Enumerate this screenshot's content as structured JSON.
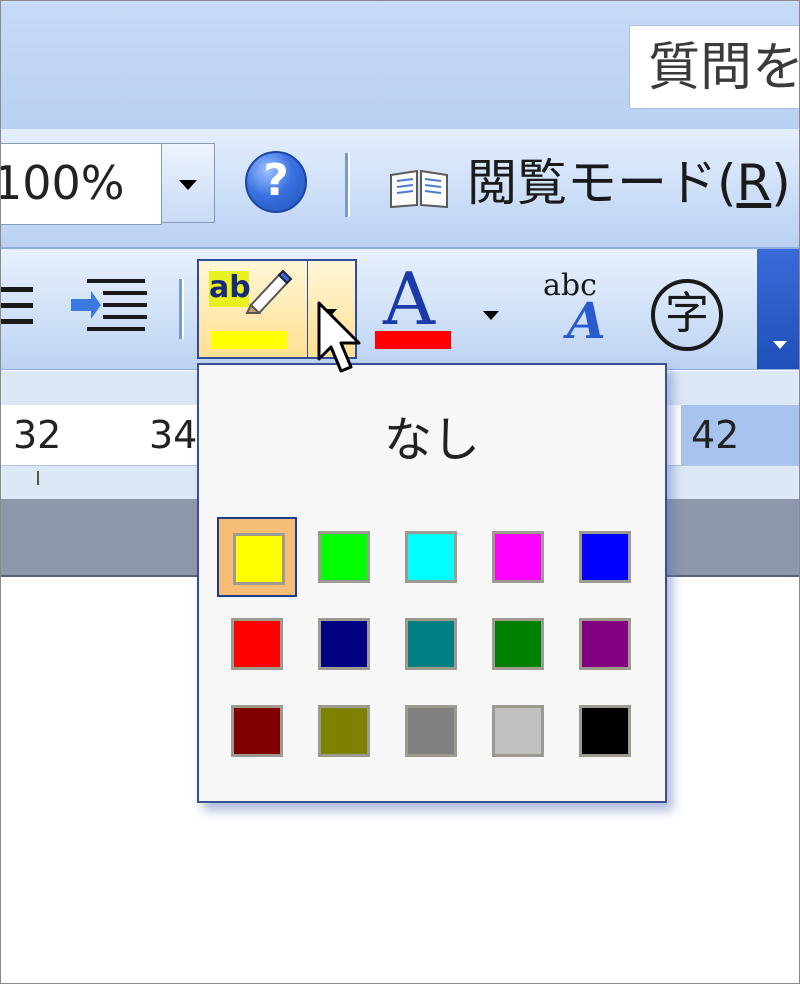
{
  "header": {
    "help_search_placeholder": "質問を入力してください"
  },
  "standard_toolbar": {
    "zoom_value": "100%",
    "help_icon_glyph": "?",
    "read_mode_label": "閲覧モード(",
    "read_mode_key": "R",
    "read_mode_close": ")"
  },
  "formatting_toolbar": {
    "highlight_icon_text": "ab",
    "font_color_glyph": "A",
    "phonetic_top": "abc",
    "phonetic_bottom": "A",
    "enclosed_char": "字"
  },
  "ruler": {
    "labels": [
      "32",
      "34",
      "42"
    ]
  },
  "highlight_palette": {
    "none_label": "なし",
    "selected_color": "#FFFF00",
    "colors": [
      [
        "#FFFF00",
        "#00FF00",
        "#00FFFF",
        "#FF00FF",
        "#0000FF"
      ],
      [
        "#FF0000",
        "#000080",
        "#008080",
        "#008000",
        "#800080"
      ],
      [
        "#800000",
        "#808000",
        "#808080",
        "#C0C0C0",
        "#000000"
      ]
    ],
    "color_names": [
      [
        "yellow",
        "bright-green",
        "turquoise",
        "pink",
        "blue"
      ],
      [
        "red",
        "dark-blue",
        "teal",
        "green",
        "violet"
      ],
      [
        "dark-red",
        "dark-yellow",
        "gray-50",
        "gray-25",
        "black"
      ]
    ]
  }
}
